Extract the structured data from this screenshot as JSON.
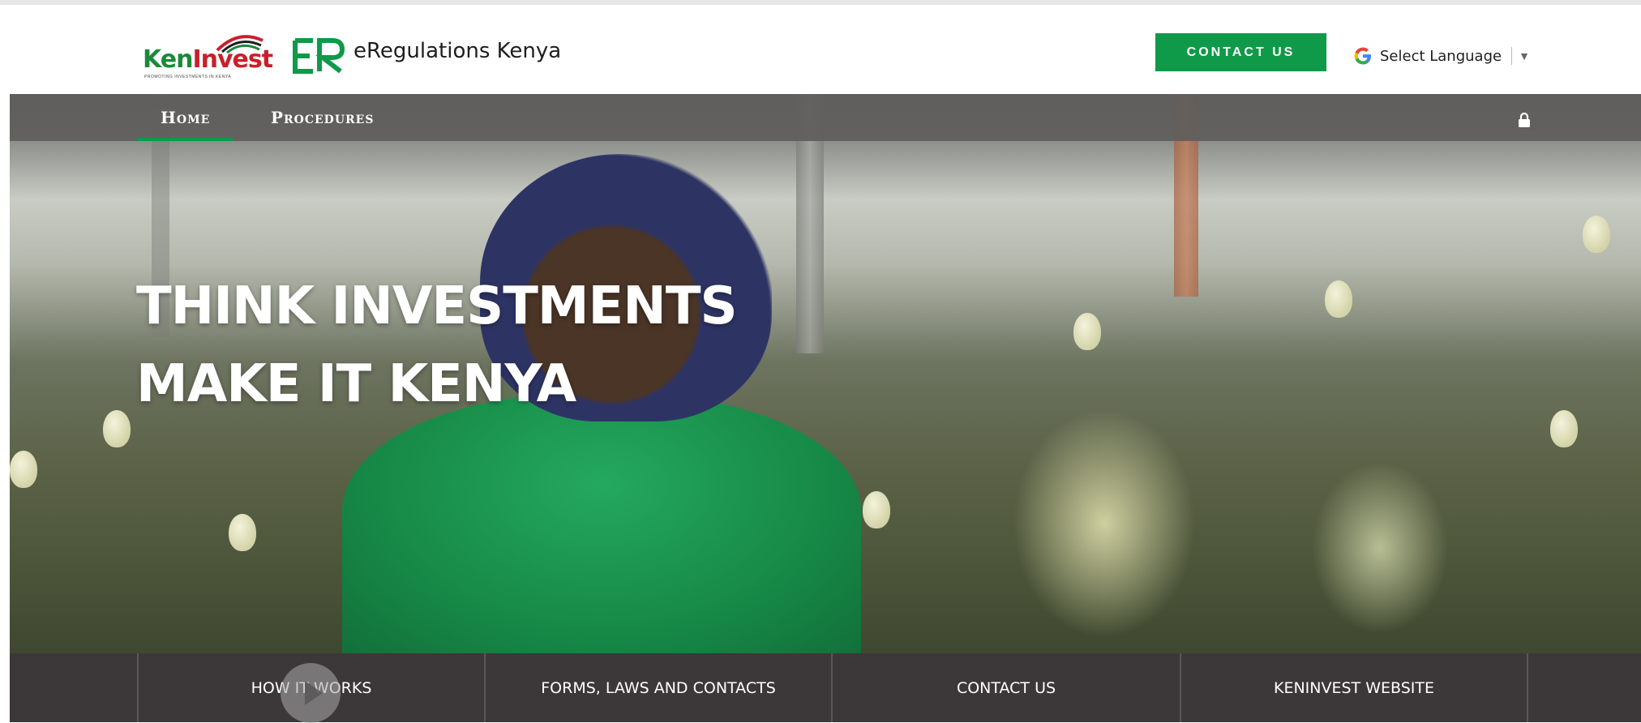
{
  "header": {
    "logo_name": "keninvest-logo",
    "logo_text_ken": "Ken",
    "logo_text_invest": "Invest",
    "logo_tagline": "PROMOTING INVESTMENTS IN KENYA",
    "site_mark": "ER",
    "site_name": "eRegulations Kenya",
    "contact_label": "CONTACT US",
    "language_label": "Select Language"
  },
  "nav": {
    "items": [
      {
        "label": "Home",
        "active": true
      },
      {
        "label": "Procedures",
        "active": false
      }
    ]
  },
  "hero": {
    "line1": "THINK INVESTMENTS",
    "line2": "MAKE IT KENYA"
  },
  "bottom_links": [
    {
      "label": "HOW IT WORKS"
    },
    {
      "label": "FORMS, LAWS AND CONTACTS"
    },
    {
      "label": "CONTACT US"
    },
    {
      "label": "KENINVEST WEBSITE"
    }
  ],
  "colors": {
    "brand_green": "#0f9a49",
    "nav_bg": "#5f5d5c",
    "bottom_bar_bg": "#3c3839",
    "logo_red": "#c8202a"
  },
  "icons": {
    "google": "google-g-icon",
    "lock": "lock-icon",
    "play": "play-icon"
  }
}
